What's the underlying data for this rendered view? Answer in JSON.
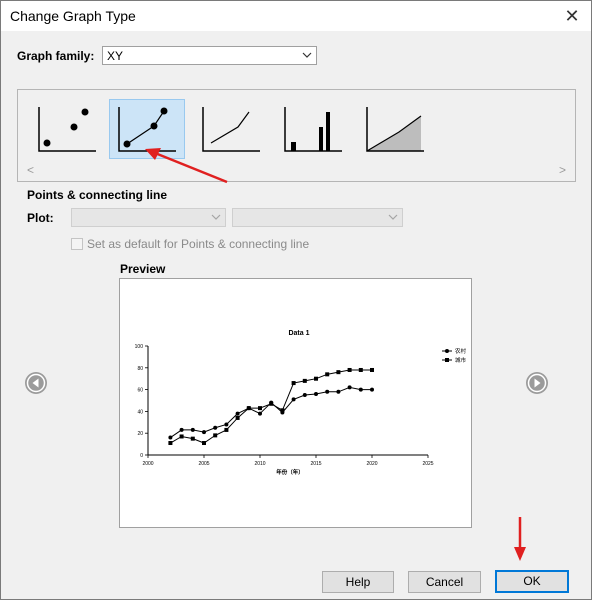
{
  "dialog": {
    "title": "Change Graph Type",
    "close_glyph": "✕"
  },
  "graph_family": {
    "label": "Graph family:",
    "value": "XY"
  },
  "gallery": {
    "thumbnails": [
      {
        "name": "points-only",
        "selected": false
      },
      {
        "name": "points-and-connecting-line",
        "selected": true
      },
      {
        "name": "connecting-line-only",
        "selected": false
      },
      {
        "name": "spikes",
        "selected": false
      },
      {
        "name": "area-fill",
        "selected": false
      }
    ],
    "scroll_left": "<",
    "scroll_right": ">"
  },
  "section": {
    "title": "Points & connecting line"
  },
  "plot": {
    "label": "Plot:",
    "value1": "",
    "value2": ""
  },
  "default_checkbox": {
    "label": "Set as default for Points & connecting line",
    "checked": false,
    "enabled": false
  },
  "preview": {
    "label": "Preview"
  },
  "chart_data": {
    "type": "line",
    "title": "Data 1",
    "xlabel": "年份（年）",
    "ylabel": "",
    "xlim": [
      2000,
      2025
    ],
    "ylim": [
      0,
      100
    ],
    "xticks": [
      "2000",
      "2005",
      "2010",
      "2015",
      "2020",
      "2025"
    ],
    "yticks": [
      "0",
      "20",
      "40",
      "60",
      "80",
      "100"
    ],
    "legend_position": "right",
    "series": [
      {
        "name": "农村",
        "marker": "circle",
        "x": [
          2002,
          2003,
          2004,
          2005,
          2006,
          2007,
          2008,
          2009,
          2010,
          2011,
          2012,
          2013,
          2014,
          2015,
          2016,
          2017,
          2018,
          2019,
          2020
        ],
        "y": [
          16,
          23,
          23,
          21,
          25,
          28,
          38,
          43,
          38,
          48,
          39,
          51,
          55,
          56,
          58,
          58,
          62,
          60,
          60
        ]
      },
      {
        "name": "城市",
        "marker": "square",
        "x": [
          2002,
          2003,
          2004,
          2005,
          2006,
          2007,
          2008,
          2009,
          2010,
          2011,
          2012,
          2013,
          2014,
          2015,
          2016,
          2017,
          2018,
          2019,
          2020
        ],
        "y": [
          11,
          17,
          15,
          11,
          18,
          23,
          34,
          43,
          43,
          47,
          41,
          66,
          68,
          70,
          74,
          76,
          78,
          78,
          78
        ]
      }
    ]
  },
  "buttons": {
    "help": "Help",
    "cancel": "Cancel",
    "ok": "OK"
  },
  "colors": {
    "selection_bg": "#cce4f7",
    "annotation_arrow": "#e02020",
    "ok_border": "#0078d7"
  }
}
